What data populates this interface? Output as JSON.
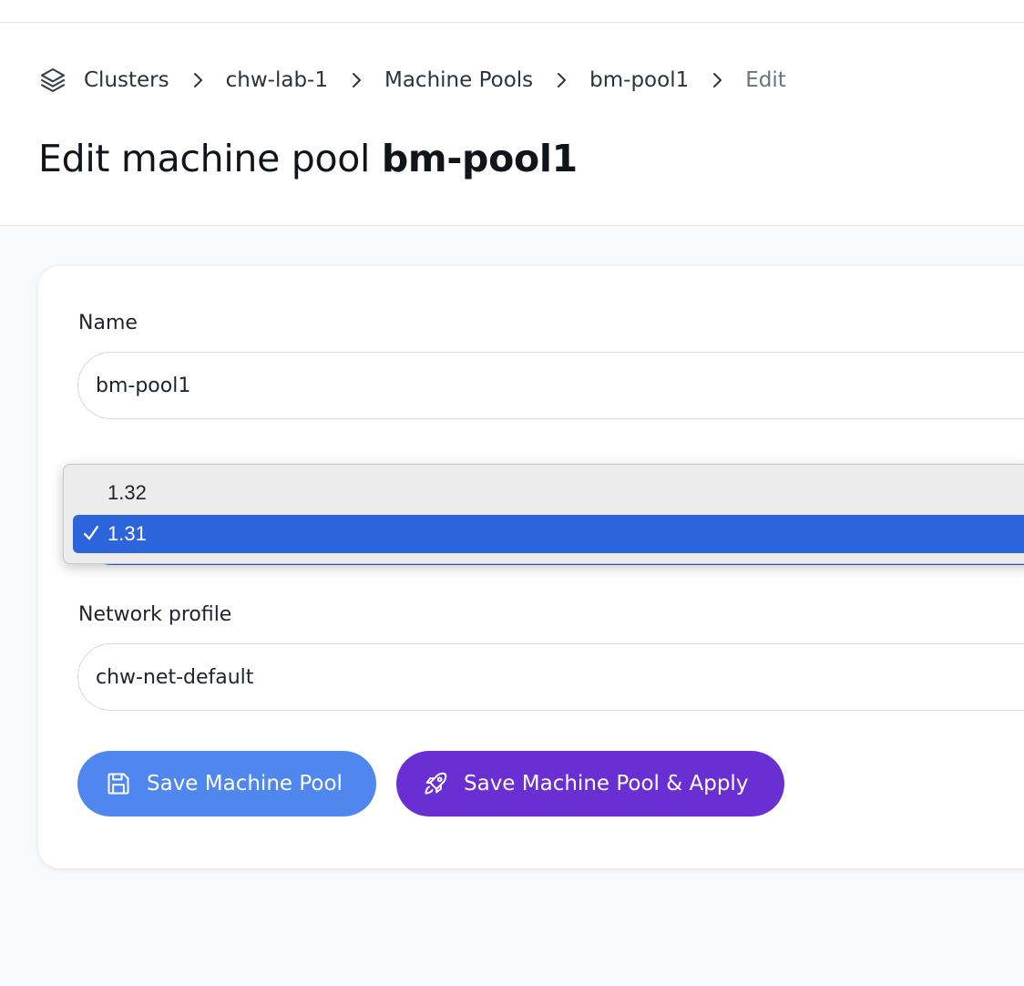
{
  "breadcrumb": {
    "icon": "layers-icon",
    "items": [
      "Clusters",
      "chw-lab-1",
      "Machine Pools",
      "bm-pool1",
      "Edit"
    ]
  },
  "page_title": {
    "prefix": "Edit machine pool",
    "pool_name": "bm-pool1"
  },
  "form": {
    "name": {
      "label": "Name",
      "value": "bm-pool1"
    },
    "version": {
      "selected": "1.31",
      "options": [
        {
          "label": "1.32",
          "selected": false
        },
        {
          "label": "1.31",
          "selected": true
        }
      ]
    },
    "network_profile": {
      "label": "Network profile",
      "value": "chw-net-default"
    }
  },
  "actions": {
    "save_label": "Save Machine Pool",
    "save_icon": "floppy-disk-icon",
    "apply_label": "Save Machine Pool & Apply",
    "apply_icon": "rocket-icon"
  },
  "colors": {
    "save_button": "#4f87ee",
    "apply_button": "#6a2fd3",
    "selected_option": "#2b64db"
  }
}
